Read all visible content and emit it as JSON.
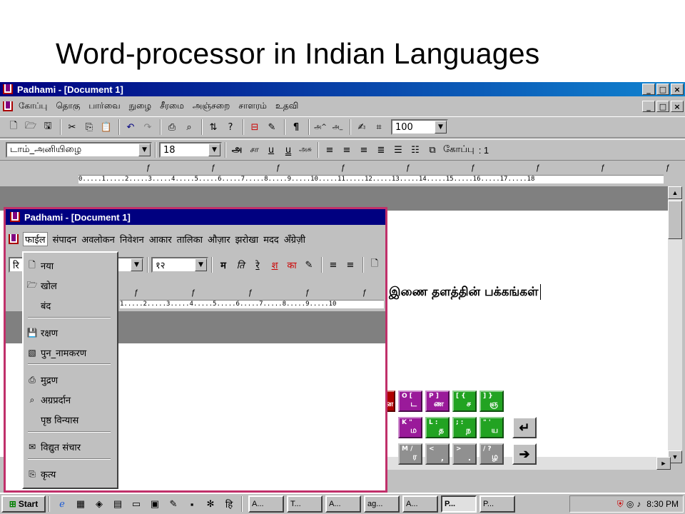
{
  "slide": {
    "title": "Word-processor in Indian Languages"
  },
  "outer_window": {
    "title": "Padhami - [Document 1]",
    "controls": [
      "_",
      "□",
      "×"
    ],
    "menu": [
      "கோப்பு",
      "தொகு",
      "பார்வை",
      "நுழை",
      "சீரமை",
      "அஞ்சறை",
      "சாளரம்",
      "உதவி"
    ],
    "zoom": "100",
    "font": "டாம்_அனியிழை",
    "size": "18",
    "format_buttons": [
      "அ",
      "சா",
      "u",
      "u",
      "அசு"
    ],
    "copy_label": "கோப்பு",
    "copy_count": ": 1",
    "ruler_numbers": [
      "0",
      "1",
      "2",
      "3",
      "4",
      "5",
      "6",
      "7",
      "8",
      "9",
      "10",
      "11",
      "12",
      "13",
      "14",
      "15",
      "16",
      "17",
      "18"
    ],
    "doc_text": "இணை தளத்தின் பக்கங்கள்"
  },
  "keyboard": [
    {
      "top": "O  [",
      "bot": "ட",
      "color": "#9a1a9a"
    },
    {
      "top": "P  ]",
      "bot": "ண",
      "color": "#9a1a9a"
    },
    {
      "top": "[  {",
      "bot": "ச",
      "color": "#22a322"
    },
    {
      "top": "]  }",
      "bot": "ஞ",
      "color": "#22a322"
    },
    {
      "top": "K  \"",
      "bot": "ம",
      "color": "#9a1a9a"
    },
    {
      "top": "L  :",
      "bot": "த",
      "color": "#22a322"
    },
    {
      "top": ";  :",
      "bot": "ந",
      "color": "#22a322"
    },
    {
      "top": "\"  '",
      "bot": "ய",
      "color": "#22a322"
    },
    {
      "top": "M  /",
      "bot": "ர",
      "color": "#909090"
    },
    {
      "top": "<",
      "bot": ",",
      "color": "#909090"
    },
    {
      "top": ">",
      "bot": ".",
      "color": "#909090"
    },
    {
      "top": "/  ?",
      "bot": "ழ",
      "color": "#909090"
    }
  ],
  "keyboard_partial": {
    "bot": "ன",
    "color": "#b00000"
  },
  "inner_window": {
    "title": "Padhami - [Document 1]",
    "menu": [
      "फाईल",
      "संपादन",
      "अवलोकन",
      "निवेशन",
      "आकार",
      "तालिका",
      "औज़ार",
      "झरोखा",
      "मदद",
      "अँग्रेज़ी"
    ],
    "font_partial": "रि",
    "size": "१२",
    "format_buttons": [
      "म",
      "ति",
      "रे",
      "श",
      "का"
    ],
    "ruler_numbers": [
      "1",
      "2",
      "3",
      "4",
      "5",
      "6",
      "7",
      "8",
      "9",
      "10"
    ],
    "file_menu": [
      {
        "label": "नया",
        "icon": "new-doc-icon",
        "glyph": "🗋"
      },
      {
        "label": "खोल",
        "icon": "open-folder-icon",
        "glyph": "🗁"
      },
      {
        "label": "बंद",
        "icon": "",
        "glyph": ""
      },
      {
        "label": "रक्षण",
        "icon": "save-icon",
        "glyph": "💾"
      },
      {
        "label": "पुन_नामकरण",
        "icon": "rename-icon",
        "glyph": "▧"
      },
      {
        "label": "मुद्रण",
        "icon": "print-icon",
        "glyph": "⎙"
      },
      {
        "label": "अग्रप्रर्दान",
        "icon": "print-preview-icon",
        "glyph": "⌕"
      },
      {
        "label": "पृष्ठ विन्यास",
        "icon": "",
        "glyph": ""
      },
      {
        "label": "विद्युत संचार",
        "icon": "email-icon",
        "glyph": "✉"
      },
      {
        "label": "कृत्य",
        "icon": "exit-icon",
        "glyph": "⎘"
      }
    ]
  },
  "taskbar": {
    "start": "Start",
    "tasks": [
      "A...",
      "T...",
      "A...",
      "ag...",
      "A...",
      "P...",
      "P..."
    ],
    "time": "8:30 PM"
  }
}
